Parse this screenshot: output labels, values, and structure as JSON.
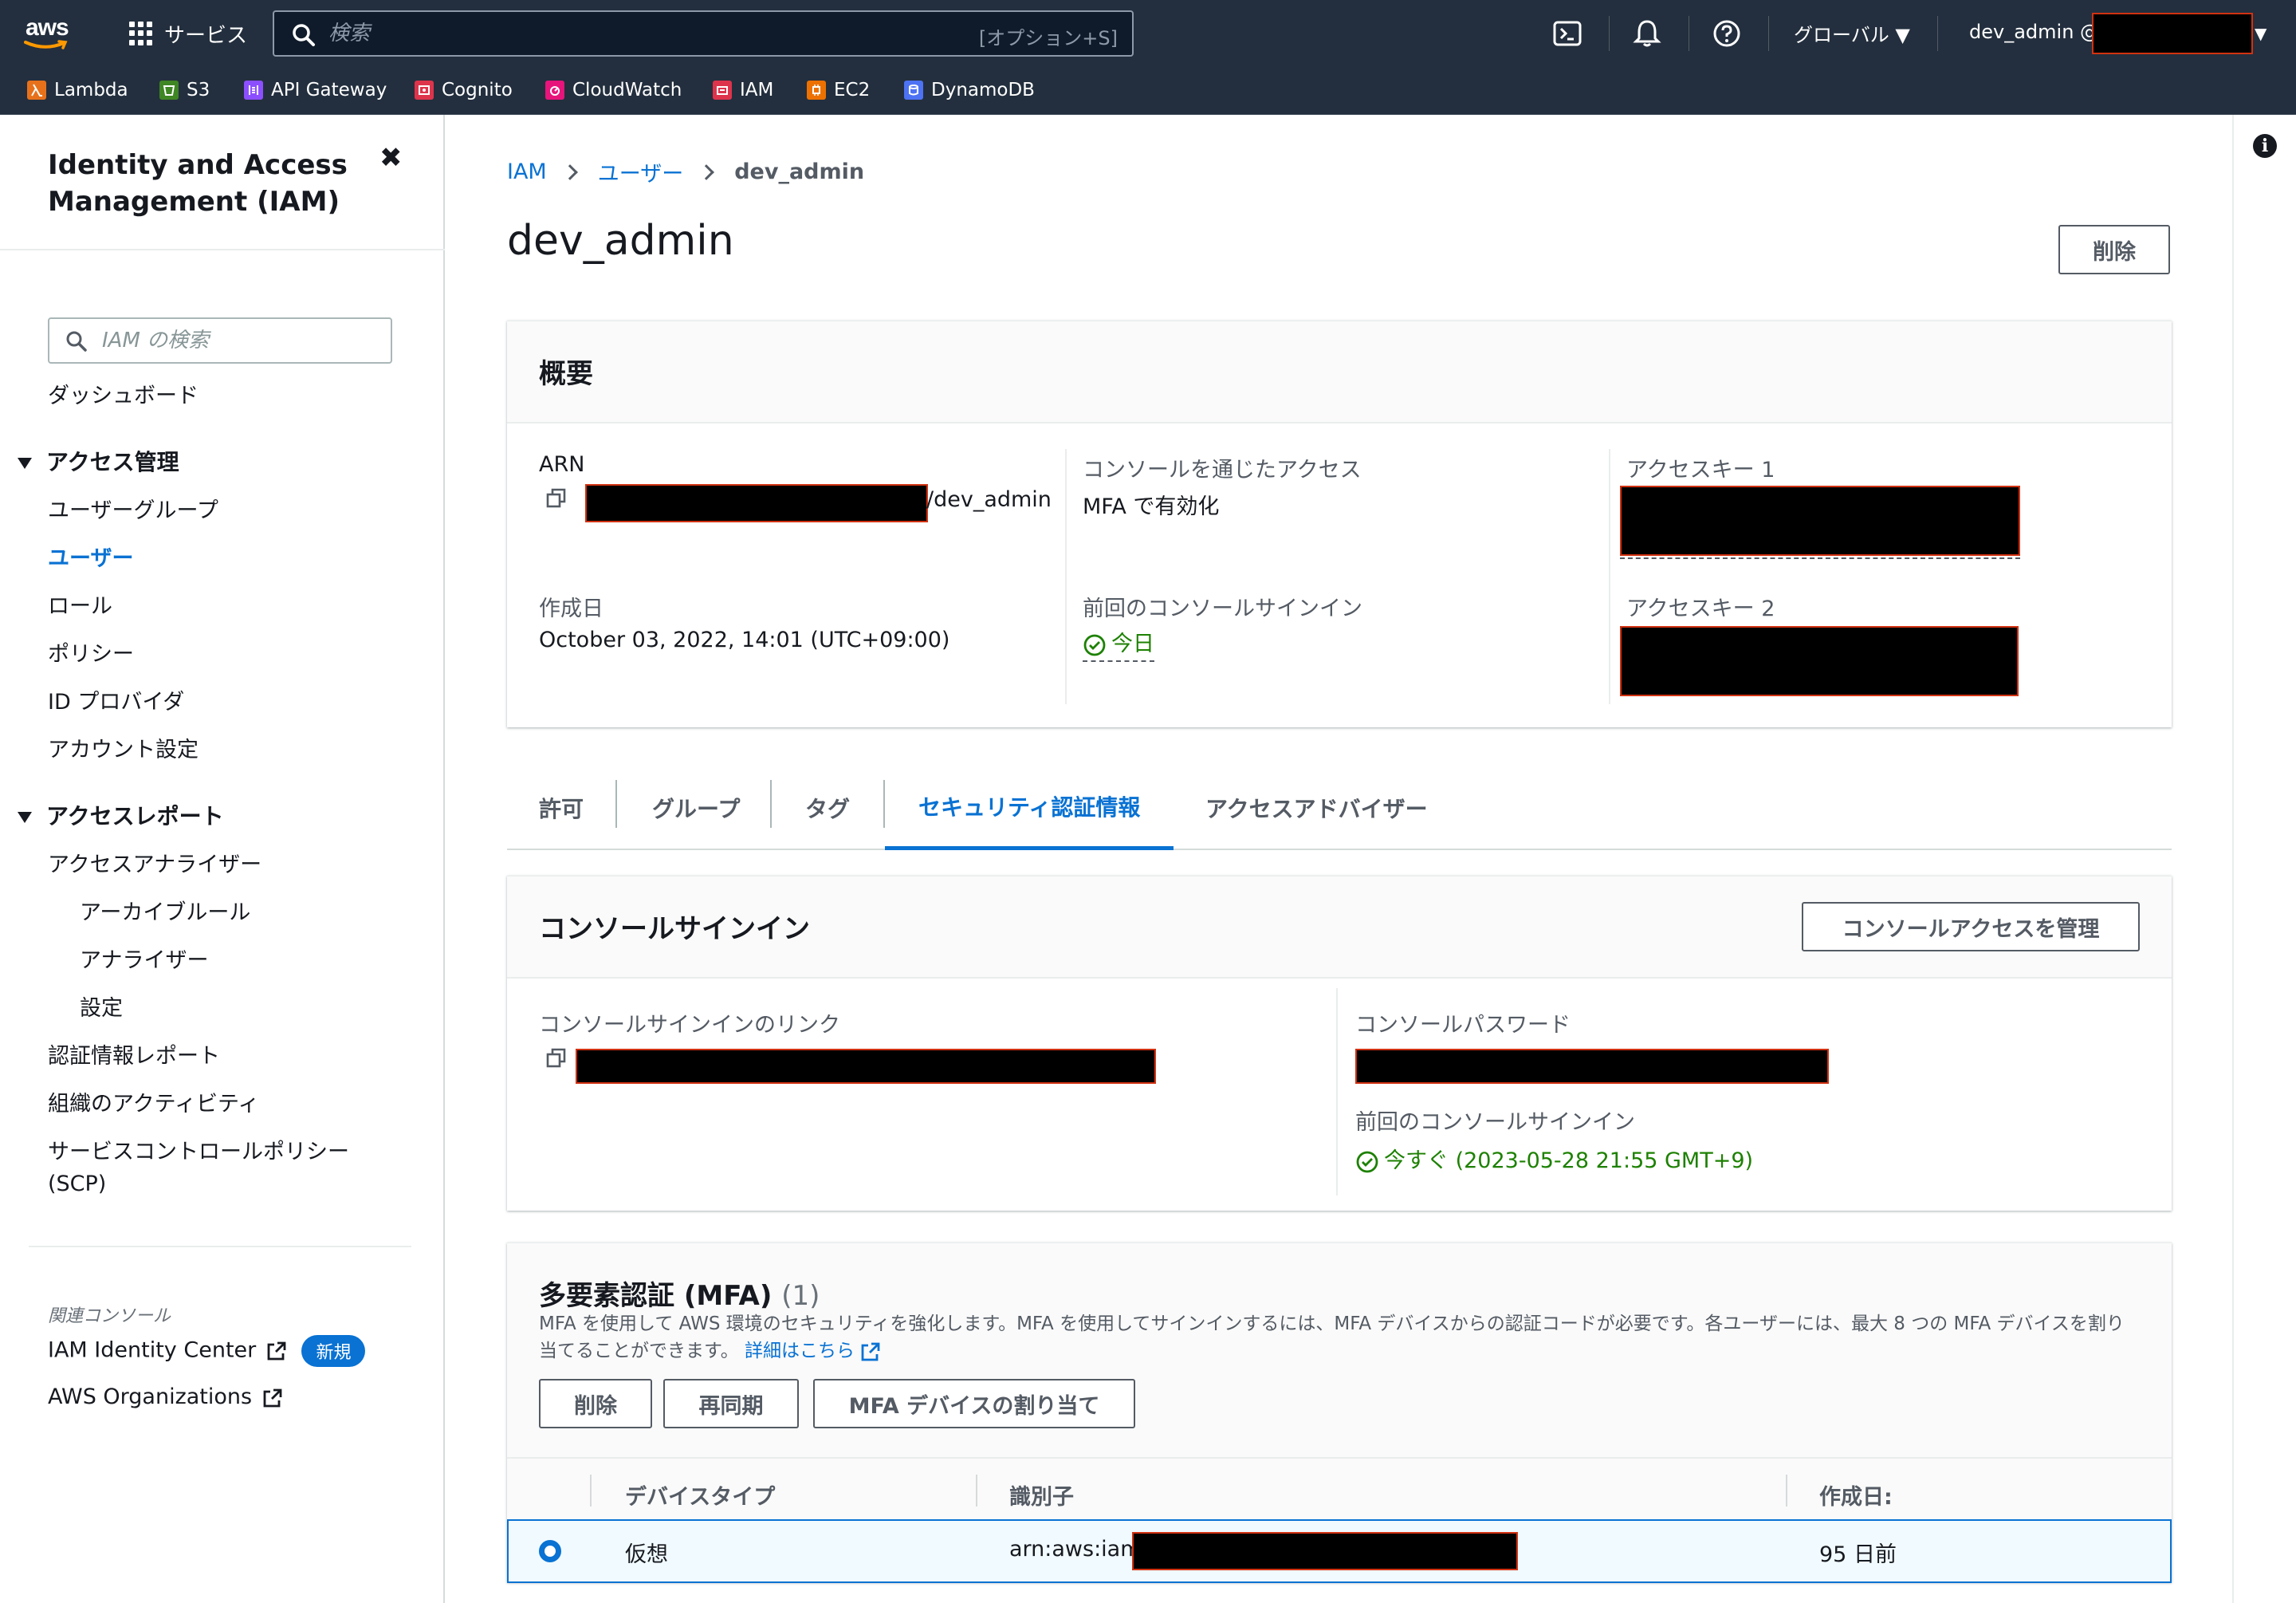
{
  "topnav": {
    "logo_text": "aws",
    "services_label": "サービス",
    "search_placeholder": "検索",
    "search_shortcut": "[オプション+S]",
    "region_label": "グローバル ▼",
    "account_label": "dev_admin @",
    "bookmarks": [
      {
        "label": "Lambda",
        "color": "#e7711b"
      },
      {
        "label": "S3",
        "color": "#3f8624"
      },
      {
        "label": "API Gateway",
        "color": "#8c4fff"
      },
      {
        "label": "Cognito",
        "color": "#dd344c"
      },
      {
        "label": "CloudWatch",
        "color": "#e7157b"
      },
      {
        "label": "IAM",
        "color": "#dd344c"
      },
      {
        "label": "EC2",
        "color": "#ed7100"
      },
      {
        "label": "DynamoDB",
        "color": "#4d72f3"
      }
    ]
  },
  "sidebar": {
    "title_line1": "Identity and Access",
    "title_line2": "Management (IAM)",
    "search_placeholder": "IAM の検索",
    "dashboard": "ダッシュボード",
    "access_mgmt": "アクセス管理",
    "access_items": [
      "ユーザーグループ",
      "ユーザー",
      "ロール",
      "ポリシー",
      "ID プロバイダ",
      "アカウント設定"
    ],
    "access_reports": "アクセスレポート",
    "report_items": [
      "アクセスアナライザー",
      "アーカイブルール",
      "アナライザー",
      "設定",
      "認証情報レポート",
      "組織のアクティビティ",
      "サービスコントロールポリシー",
      "(SCP)"
    ],
    "related_label": "関連コンソール",
    "related_1": "IAM Identity Center",
    "new_badge": "新規",
    "related_2": "AWS Organizations"
  },
  "breadcrumb": [
    "IAM",
    "ユーザー",
    "dev_admin"
  ],
  "page_title": "dev_admin",
  "delete_button": "削除",
  "summary": {
    "heading": "概要",
    "arn_label": "ARN",
    "arn_suffix": "/dev_admin",
    "created_label": "作成日",
    "created_value": "October 03, 2022, 14:01 (UTC+09:00)",
    "console_access_label": "コンソールを通じたアクセス",
    "console_access_value": "MFA で有効化",
    "last_signin_label": "前回のコンソールサインイン",
    "last_signin_value": "今日",
    "key1_label": "アクセスキー 1",
    "key2_label": "アクセスキー 2"
  },
  "tabs": [
    "許可",
    "グループ",
    "タグ",
    "セキュリティ認証情報",
    "アクセスアドバイザー"
  ],
  "active_tab": "セキュリティ認証情報",
  "console_signin": {
    "heading": "コンソールサインイン",
    "manage_button": "コンソールアクセスを管理",
    "link_label": "コンソールサインインのリンク",
    "password_label": "コンソールパスワード",
    "last_signin_label": "前回のコンソールサインイン",
    "last_signin_value": "今すぐ (2023-05-28 21:55 GMT+9)"
  },
  "mfa": {
    "heading": "多要素認証 (MFA)",
    "count": "(1)",
    "description": "MFA を使用して AWS 環境のセキュリティを強化します。MFA を使用してサインインするには、MFA デバイスからの認証コードが必要です。各ユーザーには、最大 8 つの MFA デバイスを割り当てることができます。",
    "details_link": "詳細はこちら",
    "buttons": [
      "削除",
      "再同期",
      "MFA デバイスの割り当て"
    ],
    "columns": [
      "デバイスタイプ",
      "識別子",
      "作成日:"
    ],
    "rows": [
      {
        "device_type": "仮想",
        "identifier": "arn:aws:iam",
        "created": "95 日前"
      }
    ]
  },
  "colors": {
    "accent": "#0972d3",
    "nav": "#232f3e",
    "success": "#1d8102",
    "redaction": "#000000"
  }
}
